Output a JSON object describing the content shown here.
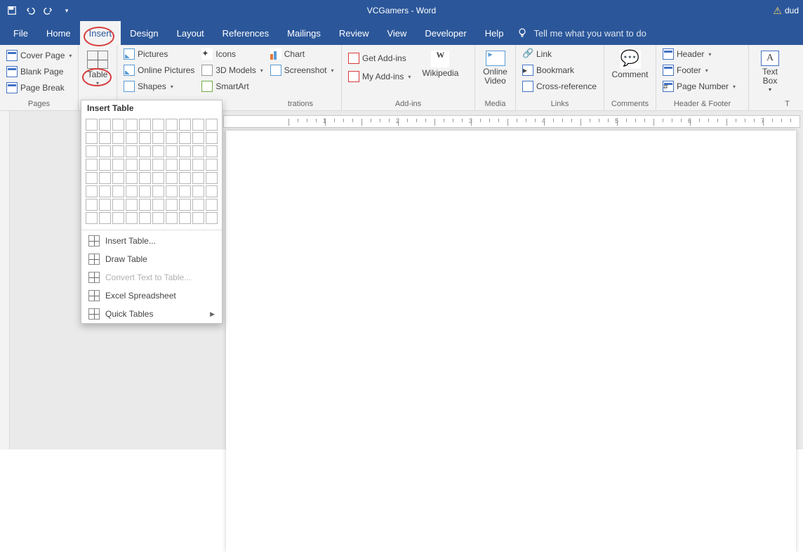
{
  "title": "VCGamers  -  Word",
  "user": "dud",
  "tabs": [
    "File",
    "Home",
    "Insert",
    "Design",
    "Layout",
    "References",
    "Mailings",
    "Review",
    "View",
    "Developer",
    "Help"
  ],
  "tell": "Tell me what you want to do",
  "ribbon": {
    "pages": {
      "label": "Pages",
      "cover": "Cover Page",
      "blank": "Blank Page",
      "break": "Page Break"
    },
    "table": {
      "label": "Table",
      "big": "Table"
    },
    "illus": {
      "label_suffix": "trations",
      "pictures": "Pictures",
      "online": "Online Pictures",
      "shapes": "Shapes",
      "icons": "Icons",
      "models": "3D Models",
      "smartart": "SmartArt",
      "chart": "Chart",
      "screenshot": "Screenshot"
    },
    "addins": {
      "label": "Add-ins",
      "get": "Get Add-ins",
      "my": "My Add-ins",
      "wiki": "Wikipedia"
    },
    "media": {
      "label": "Media",
      "video": "Online\nVideo"
    },
    "links": {
      "label": "Links",
      "link": "Link",
      "bookmark": "Bookmark",
      "cross": "Cross-reference"
    },
    "comments": {
      "label": "Comments",
      "comment": "Comment"
    },
    "hf": {
      "label": "Header & Footer",
      "header": "Header",
      "footer": "Footer",
      "pagenum": "Page Number"
    },
    "text": {
      "label_prefix": "T",
      "box": "Text\nBox"
    }
  },
  "dropdown": {
    "header": "Insert Table",
    "items": [
      {
        "label": "Insert Table...",
        "icon": "table-icon",
        "enabled": true
      },
      {
        "label": "Draw Table",
        "icon": "pencil-icon",
        "enabled": true
      },
      {
        "label": "Convert Text to Table...",
        "icon": "convert-icon",
        "enabled": false
      },
      {
        "label": "Excel Spreadsheet",
        "icon": "excel-icon",
        "enabled": true
      },
      {
        "label": "Quick Tables",
        "icon": "table-icon",
        "enabled": true,
        "submenu": true
      }
    ]
  },
  "ruler_numbers": [
    1,
    2,
    3,
    4,
    5,
    6,
    7
  ]
}
